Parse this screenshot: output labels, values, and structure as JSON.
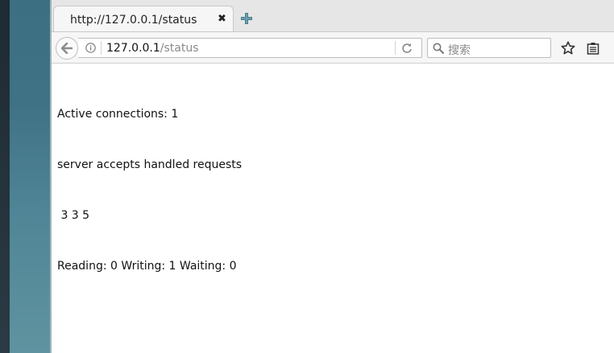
{
  "browser": {
    "tab": {
      "title": "http://127.0.0.1/status",
      "close_glyph": "✖"
    },
    "url": {
      "host": "127.0.0.1",
      "path": "/status"
    },
    "search": {
      "placeholder": "搜索"
    },
    "icons": {
      "back": "back-arrow-icon",
      "info": "info-icon",
      "reload": "reload-icon",
      "search": "search-icon",
      "bookmark": "star-icon",
      "library": "library-icon",
      "new_tab": "plus-icon"
    }
  },
  "page": {
    "lines": [
      "Active connections: 1",
      "server accepts handled requests",
      " 3 3 5",
      "Reading: 0 Writing: 1 Waiting: 0"
    ]
  },
  "colors": {
    "desktop": "#3f7285",
    "plus_icon": "#4a7c8c"
  }
}
